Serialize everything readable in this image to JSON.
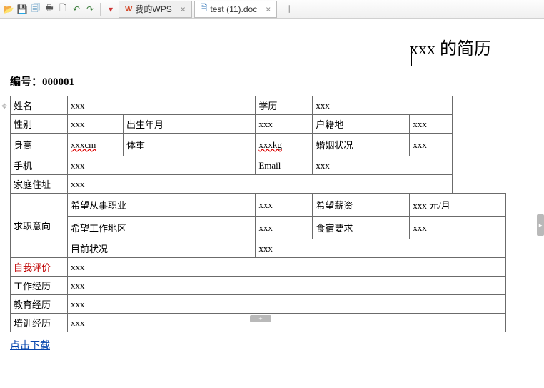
{
  "tabbar": {
    "tabs": [
      {
        "label": "我的WPS",
        "closeable": true
      },
      {
        "label": "test (11).doc",
        "closeable": true
      }
    ]
  },
  "doc": {
    "title": "xxx 的简历",
    "serial_label": "编号：",
    "serial_value": "000001",
    "download_link": "点击下载"
  },
  "labels": {
    "name": "姓名",
    "edu": "学历",
    "gender": "性别",
    "dob": "出生年月",
    "origin": "户籍地",
    "height": "身高",
    "weight": "体重",
    "marriage": "婚姻状况",
    "phone": "手机",
    "email": "Email",
    "addr": "家庭住址",
    "intent": "求职意向",
    "desired_job": "希望从事职业",
    "desired_salary": "希望薪资",
    "desired_loc": "希望工作地区",
    "board_req": "食宿要求",
    "current": "目前状况",
    "self_eval": "自我评价",
    "work_hist": "工作经历",
    "edu_hist": "教育经历",
    "train_hist": "培训经历"
  },
  "vals": {
    "name": "xxx",
    "edu": "xxx",
    "gender": "xxx",
    "dob": "xxx",
    "origin": "xxx",
    "height": "xxxcm",
    "weight": "xxxkg",
    "marriage": "xxx",
    "phone": "xxx",
    "email": "xxx",
    "addr": "xxx",
    "desired_job": "xxx",
    "desired_salary": "xxx 元/月",
    "desired_loc": "xxx",
    "board_req": "xxx",
    "current": "xxx",
    "self_eval": "xxx",
    "work_hist": "xxx",
    "edu_hist": "xxx",
    "train_hist": "xxx"
  }
}
